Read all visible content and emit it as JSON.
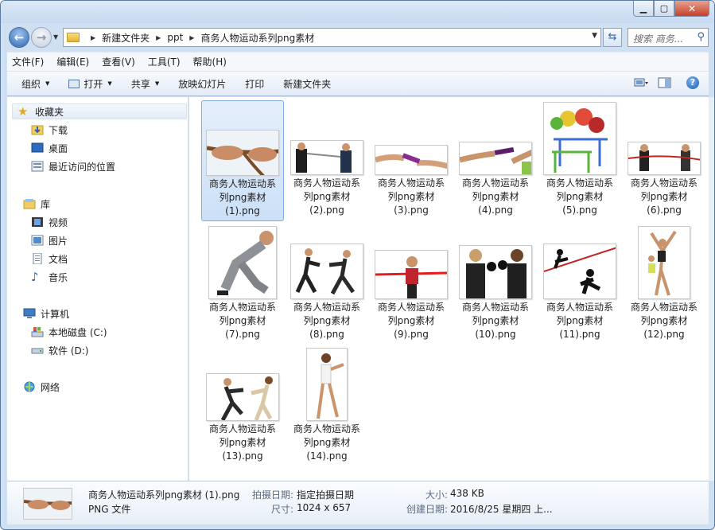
{
  "window": {
    "minimize": "▁",
    "maximize": "▢",
    "close": "✕"
  },
  "address": {
    "parts": [
      "新建文件夹",
      "ppt",
      "商务人物运动系列png素材"
    ]
  },
  "search": {
    "placeholder": "搜索 商务..."
  },
  "menu": [
    "文件(F)",
    "编辑(E)",
    "查看(V)",
    "工具(T)",
    "帮助(H)"
  ],
  "toolbar": {
    "organize": "组织",
    "open": "打开",
    "share": "共享",
    "slideshow": "放映幻灯片",
    "print": "打印",
    "newfolder": "新建文件夹"
  },
  "nav": {
    "favorites": "收藏夹",
    "downloads": "下载",
    "desktop": "桌面",
    "recent": "最近访问的位置",
    "library": "库",
    "videos": "视频",
    "pictures": "图片",
    "documents": "文档",
    "music": "音乐",
    "computer": "计算机",
    "localdisk": "本地磁盘 (C:)",
    "software": "软件 (D:)",
    "network": "网络"
  },
  "files": [
    {
      "l1": "商务人物运动系",
      "l2": "列png素材",
      "l3": "(1).png"
    },
    {
      "l1": "商务人物运动系",
      "l2": "列png素材",
      "l3": "(2).png"
    },
    {
      "l1": "商务人物运动系",
      "l2": "列png素材",
      "l3": "(3).png"
    },
    {
      "l1": "商务人物运动系",
      "l2": "列png素材",
      "l3": "(4).png"
    },
    {
      "l1": "商务人物运动系",
      "l2": "列png素材",
      "l3": "(5).png"
    },
    {
      "l1": "商务人物运动系",
      "l2": "列png素材",
      "l3": "(6).png"
    },
    {
      "l1": "商务人物运动系",
      "l2": "列png素材",
      "l3": "(7).png"
    },
    {
      "l1": "商务人物运动系",
      "l2": "列png素材",
      "l3": "(8).png"
    },
    {
      "l1": "商务人物运动系",
      "l2": "列png素材",
      "l3": "(9).png"
    },
    {
      "l1": "商务人物运动系",
      "l2": "列png素材",
      "l3": "(10).png"
    },
    {
      "l1": "商务人物运动系",
      "l2": "列png素材",
      "l3": "(11).png"
    },
    {
      "l1": "商务人物运动系",
      "l2": "列png素材",
      "l3": "(12).png"
    },
    {
      "l1": "商务人物运动系",
      "l2": "列png素材",
      "l3": "(13).png"
    },
    {
      "l1": "商务人物运动系",
      "l2": "列png素材",
      "l3": "(14).png"
    }
  ],
  "details": {
    "name": "商务人物运动系列png素材 (1).png",
    "type": "PNG 文件",
    "date_taken_label": "拍摄日期:",
    "date_taken": "指定拍摄日期",
    "dims_label": "尺寸:",
    "dims": "1024 x 657",
    "size_label": "大小:",
    "size": "438 KB",
    "created_label": "创建日期:",
    "created": "2016/8/25 星期四 上..."
  }
}
